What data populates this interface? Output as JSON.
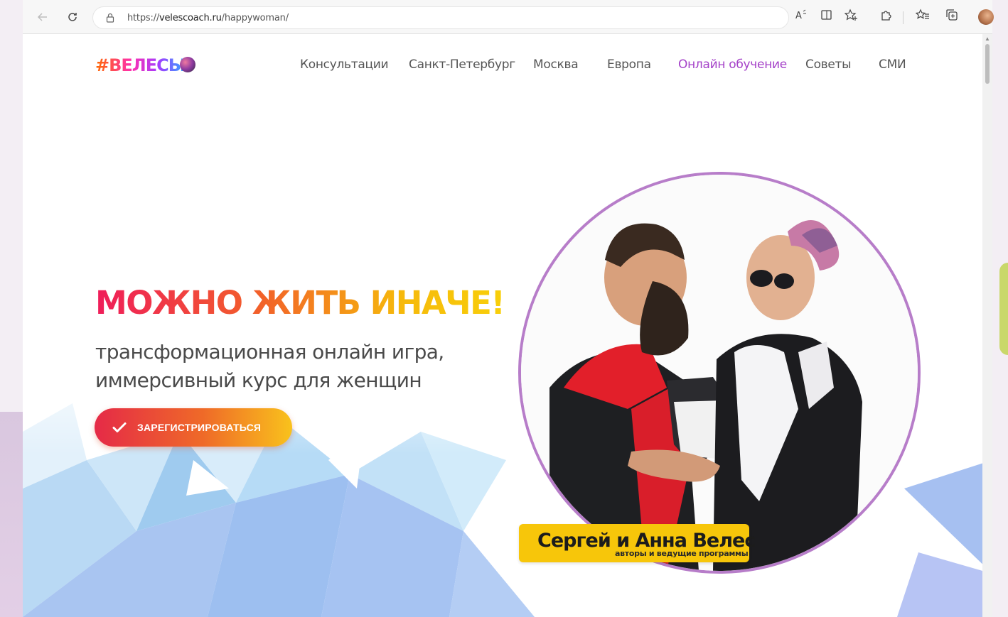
{
  "browser": {
    "url_scheme": "https://",
    "url_host": "velescoach.ru",
    "url_path": "/happywoman/",
    "back_icon": "arrow-left-icon",
    "reload_icon": "reload-icon",
    "toolbar_icons": [
      "read-aloud-icon",
      "immersive-reader-icon",
      "add-favorite-icon",
      "extensions-icon",
      "favorites-icon",
      "collections-icon",
      "profile-avatar"
    ]
  },
  "site": {
    "logo_text": "#ВЕЛЕСЫ",
    "nav": [
      {
        "label": "Консультации"
      },
      {
        "label": "Санкт-Петербург"
      },
      {
        "label": "Москва"
      },
      {
        "label": "Европа"
      },
      {
        "label": "Онлайн обучение",
        "active": true
      },
      {
        "label": "Советы"
      },
      {
        "label": "СМИ"
      }
    ]
  },
  "hero": {
    "headline": "МОЖНО ЖИТЬ ИНАЧЕ!",
    "subline_1": "трансформационная онлайн игра,",
    "subline_2": "иммерсивный курс для женщин",
    "cta_label": "ЗАРЕГИСТРИРОВАТЬСЯ",
    "caption_name": "Сергей и Анна Велес",
    "caption_role": "авторы и ведущие программы"
  },
  "colors": {
    "nav_active": "#a441c8",
    "photo_border": "#b77dc9",
    "caption_bg": "#f7c60a",
    "cta_start": "#e52a47",
    "cta_end": "#f9c21c"
  }
}
